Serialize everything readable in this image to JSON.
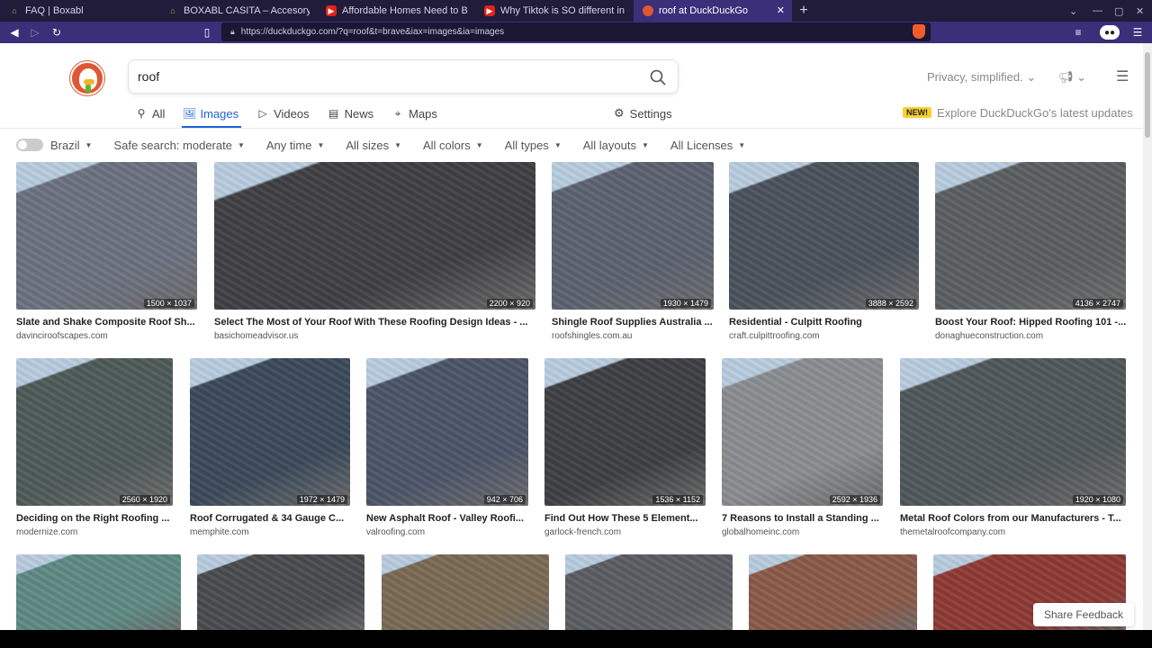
{
  "browser": {
    "tabs": [
      {
        "label": "FAQ | Boxabl",
        "icon": "boxabl-icon",
        "active": false
      },
      {
        "label": "BOXABL CASITA – Accesory D",
        "icon": "boxabl-icon",
        "active": false
      },
      {
        "label": "Affordable Homes Need to Be",
        "icon": "youtube-icon",
        "active": false
      },
      {
        "label": "Why Tiktok is SO different in C",
        "icon": "youtube-icon",
        "active": false
      },
      {
        "label": "roof at DuckDuckGo",
        "icon": "duckduckgo-icon",
        "active": true
      }
    ],
    "new_tab": "+",
    "url": "https://duckduckgo.com/?q=roof&t=brave&iax=images&ia=images"
  },
  "search": {
    "query": "roof"
  },
  "header": {
    "privacy_label": "Privacy, simplified.",
    "new_badge": "NEW!",
    "explore_text": "Explore DuckDuckGo's latest updates",
    "settings_label": "Settings"
  },
  "nav_tabs": [
    {
      "label": "All",
      "icon": "search-icon"
    },
    {
      "label": "Images",
      "icon": "image-icon",
      "active": true
    },
    {
      "label": "Videos",
      "icon": "play-icon"
    },
    {
      "label": "News",
      "icon": "newspaper-icon"
    },
    {
      "label": "Maps",
      "icon": "map-pin-icon"
    }
  ],
  "filters": [
    {
      "label": "Brazil"
    },
    {
      "label": "Safe search: moderate"
    },
    {
      "label": "Any time"
    },
    {
      "label": "All sizes"
    },
    {
      "label": "All colors"
    },
    {
      "label": "All types"
    },
    {
      "label": "All layouts"
    },
    {
      "label": "All Licenses"
    }
  ],
  "results_row1": [
    {
      "title": "Slate and Shake Composite Roof Sh...",
      "domain": "davinciroofscapes.com",
      "dims": "1500 × 1037",
      "color": "#6b7280"
    },
    {
      "title": "Select The Most of Your Roof With These Roofing Design Ideas - ...",
      "domain": "basichomeadvisor.us",
      "dims": "2200 × 920",
      "color": "#3f3f44"
    },
    {
      "title": "Shingle Roof Supplies Australia ...",
      "domain": "roofshingles.com.au",
      "dims": "1930 × 1479",
      "color": "#5c6270"
    },
    {
      "title": "Residential - Culpitt Roofing",
      "domain": "craft.culpittroofing.com",
      "dims": "3888 × 2592",
      "color": "#4a525c"
    },
    {
      "title": "Boost Your Roof: Hipped Roofing 101 -...",
      "domain": "donaghueconstruction.com",
      "dims": "4136 × 2747",
      "color": "#5b5f62"
    }
  ],
  "results_row2": [
    {
      "title": "Deciding on the Right Roofing ...",
      "domain": "modernize.com",
      "dims": "2560 × 1920",
      "color": "#4e5a58"
    },
    {
      "title": "Roof Corrugated & 34 Gauge C...",
      "domain": "memphite.com",
      "dims": "1972 × 1479",
      "color": "#3b4a5a"
    },
    {
      "title": "New Asphalt Roof - Valley Roofi...",
      "domain": "valroofing.com",
      "dims": "942 × 706",
      "color": "#4c5568"
    },
    {
      "title": "Find Out How These 5 Element...",
      "domain": "garlock-french.com",
      "dims": "1536 × 1152",
      "color": "#3d3f42"
    },
    {
      "title": "7 Reasons to Install a Standing ...",
      "domain": "globalhomeinc.com",
      "dims": "2592 × 1936",
      "color": "#8a8d91"
    },
    {
      "title": "Metal Roof Colors from our Manufacturers - T...",
      "domain": "themetalroofcompany.com",
      "dims": "1920 × 1080",
      "color": "#50575a"
    }
  ],
  "results_row3": [
    {
      "color": "#5e8a83"
    },
    {
      "color": "#4a4b4e"
    },
    {
      "color": "#7a6a55"
    },
    {
      "color": "#5a5d63"
    },
    {
      "color": "#8a5a48"
    },
    {
      "color": "#8e3a34"
    }
  ],
  "feedback_label": "Share Feedback"
}
